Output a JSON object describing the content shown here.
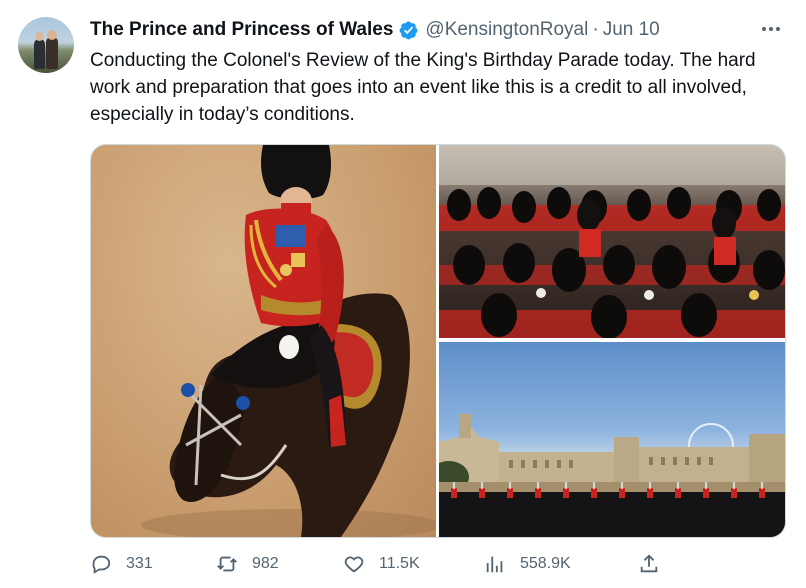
{
  "author": {
    "name": "The Prince and Princess of Wales",
    "handle": "@KensingtonRoyal",
    "separator": "·",
    "date": "Jun 10",
    "verified_color": "#1d9bf0"
  },
  "tweet": {
    "text": "Conducting the Colonel's Review of the King's Birthday Parade today. The hard work and preparation that goes into an event like this is a credit to all involved, especially in today’s conditions."
  },
  "media": {
    "images": [
      "officer-on-horseback-photo",
      "guardsmen-formation-photo",
      "horse-guards-parade-photo"
    ]
  },
  "actions": {
    "reply_count": "331",
    "retweet_count": "982",
    "like_count": "11.5K",
    "views_count": "558.9K"
  },
  "icons": {
    "reply": "reply-icon",
    "retweet": "retweet-icon",
    "like": "heart-icon",
    "views": "views-icon",
    "share": "share-icon",
    "more": "more-icon"
  },
  "colors": {
    "text": "#0f1419",
    "secondary": "#536471",
    "accent": "#1d9bf0"
  }
}
